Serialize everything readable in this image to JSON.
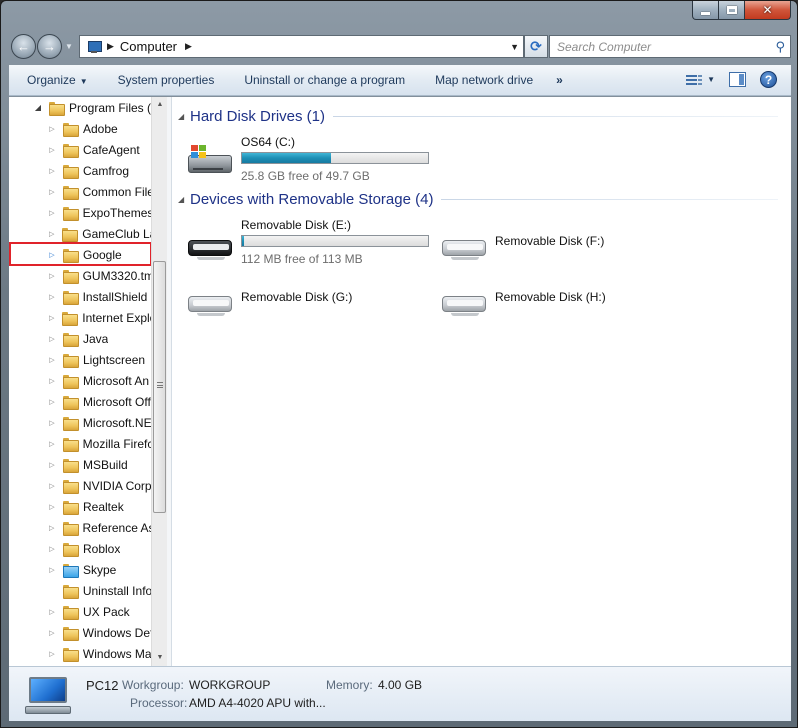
{
  "address": {
    "crumb": "Computer",
    "search_placeholder": "Search Computer"
  },
  "commands": {
    "organize": "Organize",
    "system_properties": "System properties",
    "uninstall": "Uninstall or change a program",
    "map_drive": "Map network drive",
    "more": "»",
    "help": "?"
  },
  "tree": {
    "parent": "Program Files (",
    "items": [
      "Adobe",
      "CafeAgent",
      "Camfrog",
      "Common File",
      "ExpoThemes",
      "GameClub La",
      "Google",
      "GUM3320.tm",
      "InstallShield I",
      "Internet Explo",
      "Java",
      "Lightscreen",
      "Microsoft An",
      "Microsoft Off",
      "Microsoft.NE",
      "Mozilla Firefc",
      "MSBuild",
      "NVIDIA Corp",
      "Realtek",
      "Reference As",
      "Roblox",
      "Skype",
      "Uninstall Info",
      "UX Pack",
      "Windows Def",
      "Windows Ma"
    ]
  },
  "groups": {
    "hdd_title": "Hard Disk Drives (1)",
    "removable_title": "Devices with Removable Storage (4)"
  },
  "drives": {
    "c": {
      "name": "OS64 (C:)",
      "free": "25.8 GB free of 49.7 GB",
      "used_fraction": 0.48
    },
    "e": {
      "name": "Removable Disk (E:)",
      "free": "112 MB free of 113 MB",
      "used_fraction": 0.01
    },
    "f": {
      "name": "Removable Disk (F:)"
    },
    "g": {
      "name": "Removable Disk (G:)"
    },
    "h": {
      "name": "Removable Disk (H:)"
    }
  },
  "details": {
    "pc_name": "PC12",
    "workgroup_label": "Workgroup:",
    "workgroup_value": "WORKGROUP",
    "memory_label": "Memory:",
    "memory_value": "4.00 GB",
    "processor_label": "Processor:",
    "processor_value": "AMD A4-4020 APU with..."
  },
  "colors": {
    "accent_title": "#1e3287",
    "highlight_box": "#e0232a",
    "drive_bar_fill": "#1d8fb5"
  }
}
